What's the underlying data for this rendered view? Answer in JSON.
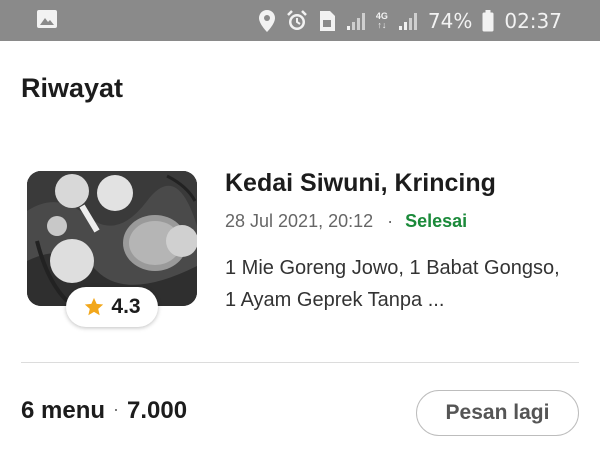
{
  "status_bar": {
    "battery_percent": "74%",
    "time": "02:37",
    "network": "4G",
    "icons": [
      "gallery-icon",
      "location-icon",
      "alarm-icon",
      "sim-icon",
      "signal-icon",
      "battery-icon"
    ]
  },
  "header": {
    "title": "Riwayat"
  },
  "order": {
    "restaurant_name": "Kedai Siwuni, Krincing",
    "datetime": "28 Jul 2021, 20:12",
    "separator": "·",
    "status": "Selesai",
    "items_summary": "1 Mie Goreng Jowo, 1 Babat Gongso, 1 Ayam Geprek Tanpa ...",
    "rating": "4.3",
    "menu_count": "6 menu",
    "total": "7.000",
    "reorder_label": "Pesan lagi"
  },
  "colors": {
    "status_bar_bg": "#8a8a8a",
    "status_completed": "#1b8a3a",
    "star": "#f2a71b"
  }
}
